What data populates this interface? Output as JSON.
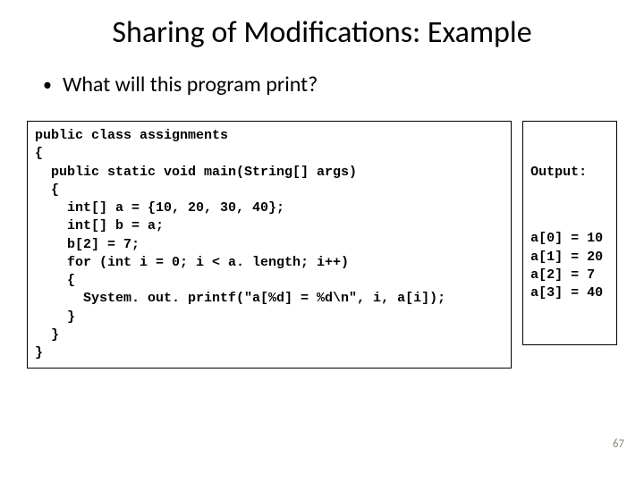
{
  "title": "Sharing of Modifications: Example",
  "bullet": "What will this program print?",
  "code": "public class assignments\n{\n  public static void main(String[] args)\n  {\n    int[] a = {10, 20, 30, 40};\n    int[] b = a;\n    b[2] = 7;\n    for (int i = 0; i < a. length; i++)\n    {\n      System. out. printf(\"a[%d] = %d\\n\", i, a[i]);\n    }\n  }\n}",
  "output": {
    "heading": "Output:",
    "lines": "a[0] = 10\na[1] = 20\na[2] = 7\na[3] = 40"
  },
  "page_number": "67"
}
